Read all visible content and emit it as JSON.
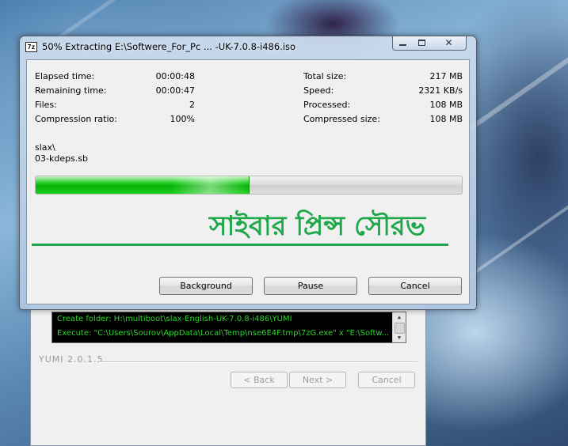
{
  "extract_window": {
    "app_icon_text": "7z",
    "title": "50% Extracting E:\\Softwere_For_Pc ... -UK-7.0.8-i486.iso",
    "stats_left": [
      {
        "label": "Elapsed time:",
        "value": "00:00:48"
      },
      {
        "label": "Remaining time:",
        "value": "00:00:47"
      },
      {
        "label": "Files:",
        "value": "2"
      },
      {
        "label": "Compression ratio:",
        "value": "100%"
      }
    ],
    "stats_right": [
      {
        "label": "Total size:",
        "value": "217 MB"
      },
      {
        "label": "Speed:",
        "value": "2321 KB/s"
      },
      {
        "label": "Processed:",
        "value": "108 MB"
      },
      {
        "label": "Compressed size:",
        "value": "108 MB"
      }
    ],
    "current_folder": "slax\\",
    "current_file": "03-kdeps.sb",
    "progress_fraction": 0.5,
    "progress_color": "#06b106",
    "watermark": "সাইবার প্রিন্স সৌরভ",
    "watermark_color": "#1ea84a",
    "buttons": {
      "background": "Background",
      "pause": "Pause",
      "cancel": "Cancel"
    },
    "caption_icons": [
      "minimize-icon",
      "maximize-icon",
      "close-icon"
    ]
  },
  "yumi_window": {
    "log_lines": [
      "Create folder: H:\\multiboot\\slax-English-UK-7.0.8-i486\\YUMI",
      "Execute: \"C:\\Users\\Sourov\\AppData\\Local\\Temp\\nse6E4F.tmp\\7zG.exe\" x \"E:\\Softw..."
    ],
    "log_text_color": "#2bd62b",
    "version": "YUMI 2.0.1.5",
    "buttons": {
      "back": "< Back",
      "next": "Next >",
      "cancel": "Cancel"
    }
  }
}
